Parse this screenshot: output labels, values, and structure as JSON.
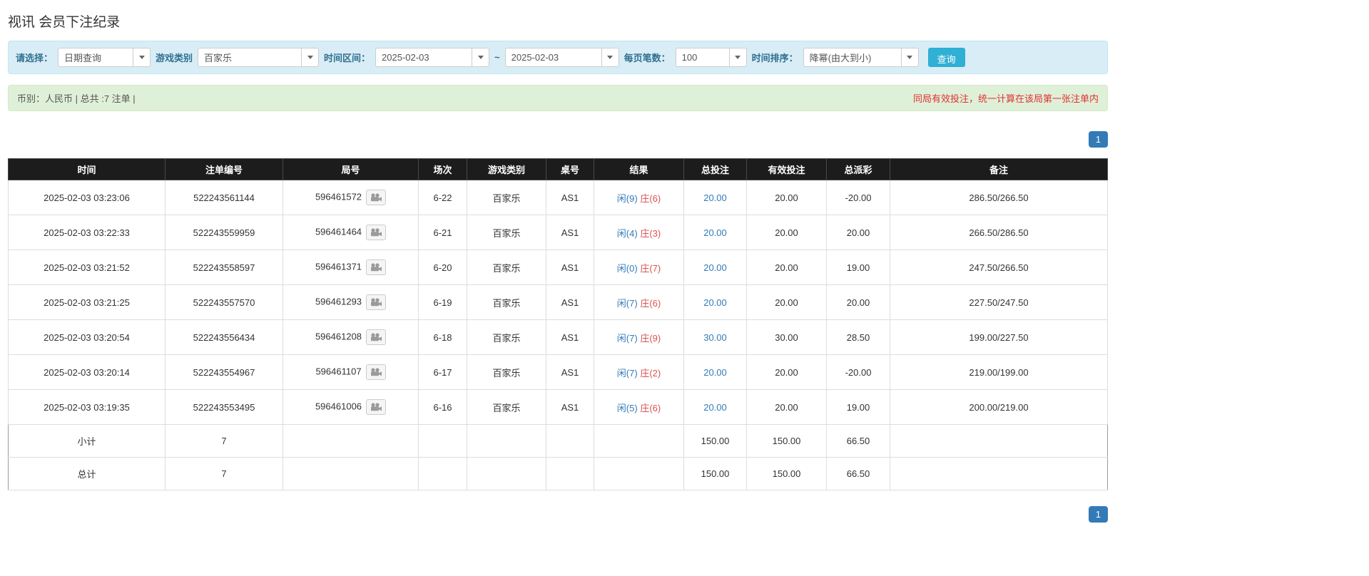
{
  "page": {
    "title": "视讯 会员下注纪录"
  },
  "filters": {
    "select_label": "请选择：",
    "select_value": "日期查询",
    "game_type_label": "游戏类别",
    "game_type_value": "百家乐",
    "date_range_label": "时间区间：",
    "date_from": "2025-02-03",
    "date_separator": "~",
    "date_to": "2025-02-03",
    "per_page_label": "每页笔数：",
    "per_page_value": "100",
    "sort_label": "时间排序：",
    "sort_value": "降幂(由大到小)",
    "search_button": "查询"
  },
  "summary": {
    "left": "币别：人民币 | 总共 :7 注单 |",
    "right": "同局有效投注，统一计算在该局第一张注单内"
  },
  "pagination": {
    "page": "1"
  },
  "icons": {
    "dropdown_caret": "▼",
    "video_replay": "video-camera"
  },
  "colors": {
    "accent_blue": "#337ab7",
    "player_blue": "#337ab7",
    "banker_red": "#d9534f",
    "negative_red": "#d9534f",
    "note_red": "#e03131",
    "filter_bg": "#d9edf7",
    "summary_bg": "#dff0d8",
    "header_bg": "#1c1c1c",
    "aggregate_bg": "#9b9b9b",
    "search_button_bg": "#31b0d5"
  },
  "table": {
    "headers": [
      "时间",
      "注单编号",
      "局号",
      "场次",
      "游戏类别",
      "桌号",
      "结果",
      "总投注",
      "有效投注",
      "总派彩",
      "备注"
    ],
    "rows": [
      {
        "time": "2025-02-03 03:23:06",
        "bet_id": "522243561144",
        "round": "596461572",
        "session": "6-22",
        "game": "百家乐",
        "table_no": "AS1",
        "result_player": "闲(9)",
        "result_banker": "庄(6)",
        "total_bet": "20.00",
        "valid_bet": "20.00",
        "payout": "-20.00",
        "note": "286.50/266.50"
      },
      {
        "time": "2025-02-03 03:22:33",
        "bet_id": "522243559959",
        "round": "596461464",
        "session": "6-21",
        "game": "百家乐",
        "table_no": "AS1",
        "result_player": "闲(4)",
        "result_banker": "庄(3)",
        "total_bet": "20.00",
        "valid_bet": "20.00",
        "payout": "20.00",
        "note": "266.50/286.50"
      },
      {
        "time": "2025-02-03 03:21:52",
        "bet_id": "522243558597",
        "round": "596461371",
        "session": "6-20",
        "game": "百家乐",
        "table_no": "AS1",
        "result_player": "闲(0)",
        "result_banker": "庄(7)",
        "total_bet": "20.00",
        "valid_bet": "20.00",
        "payout": "19.00",
        "note": "247.50/266.50"
      },
      {
        "time": "2025-02-03 03:21:25",
        "bet_id": "522243557570",
        "round": "596461293",
        "session": "6-19",
        "game": "百家乐",
        "table_no": "AS1",
        "result_player": "闲(7)",
        "result_banker": "庄(6)",
        "total_bet": "20.00",
        "valid_bet": "20.00",
        "payout": "20.00",
        "note": "227.50/247.50"
      },
      {
        "time": "2025-02-03 03:20:54",
        "bet_id": "522243556434",
        "round": "596461208",
        "session": "6-18",
        "game": "百家乐",
        "table_no": "AS1",
        "result_player": "闲(7)",
        "result_banker": "庄(9)",
        "total_bet": "30.00",
        "valid_bet": "30.00",
        "payout": "28.50",
        "note": "199.00/227.50"
      },
      {
        "time": "2025-02-03 03:20:14",
        "bet_id": "522243554967",
        "round": "596461107",
        "session": "6-17",
        "game": "百家乐",
        "table_no": "AS1",
        "result_player": "闲(7)",
        "result_banker": "庄(2)",
        "total_bet": "20.00",
        "valid_bet": "20.00",
        "payout": "-20.00",
        "note": "219.00/199.00"
      },
      {
        "time": "2025-02-03 03:19:35",
        "bet_id": "522243553495",
        "round": "596461006",
        "session": "6-16",
        "game": "百家乐",
        "table_no": "AS1",
        "result_player": "闲(5)",
        "result_banker": "庄(6)",
        "total_bet": "20.00",
        "valid_bet": "20.00",
        "payout": "19.00",
        "note": "200.00/219.00"
      }
    ],
    "subtotal": {
      "label": "小计",
      "count": "7",
      "total_bet": "150.00",
      "valid_bet": "150.00",
      "payout": "66.50"
    },
    "total": {
      "label": "总计",
      "count": "7",
      "total_bet": "150.00",
      "valid_bet": "150.00",
      "payout": "66.50"
    }
  }
}
